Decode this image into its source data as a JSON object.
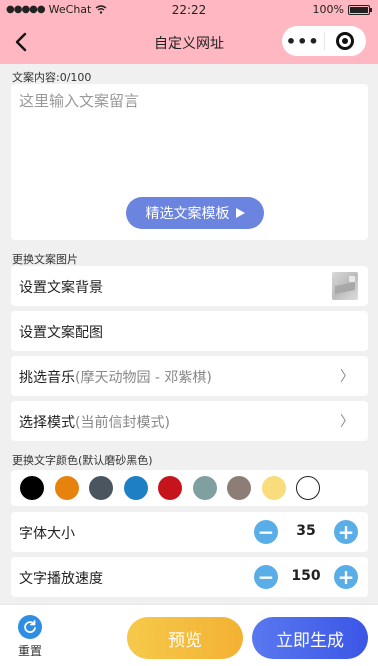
{
  "status_bar": {
    "carrier": "WeChat",
    "time": "22:22",
    "battery": "100%"
  },
  "nav": {
    "title": "自定义网址"
  },
  "content": {
    "label": "文案内容:0/100",
    "placeholder": "这里输入文案留言",
    "template_button": "精选文案模板"
  },
  "image_section": {
    "label": "更换文案图片",
    "set_background": "设置文案背景",
    "set_image": "设置文案配图"
  },
  "music": {
    "label": "挑选音乐",
    "value": "(摩天动物园 - 邓紫棋)"
  },
  "mode": {
    "label": "选择模式",
    "value": "(当前信封模式)"
  },
  "color_section": {
    "label": "更换文字颜色(默认磨砂黑色)",
    "colors": [
      "#000000",
      "#e8820e",
      "#4a5560",
      "#1f7fc4",
      "#c6141d",
      "#7f9fa0",
      "#8c7e76",
      "#f9dd7d",
      "#ffffff"
    ]
  },
  "font_size": {
    "label": "字体大小",
    "value": "35"
  },
  "speed": {
    "label": "文字播放速度",
    "value": "150"
  },
  "bottom": {
    "reset": "重置",
    "preview": "预览",
    "generate": "立即生成"
  }
}
